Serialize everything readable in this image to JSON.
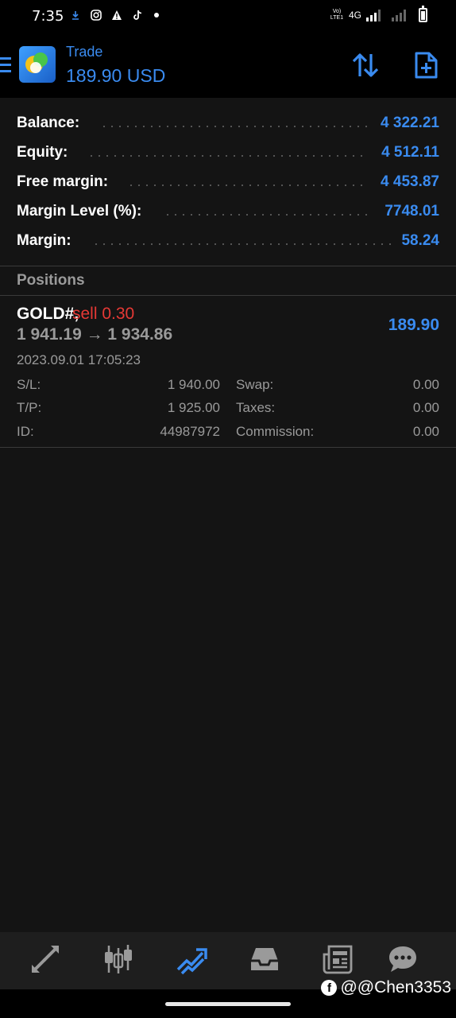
{
  "status_bar": {
    "time": "7:35",
    "volte": "Vo) LTE1",
    "network": "4G"
  },
  "header": {
    "title": "Trade",
    "subtitle": "189.90 USD",
    "icons": [
      "menu-icon",
      "app-logo",
      "sort-icon",
      "new-order-icon"
    ]
  },
  "account": {
    "rows": [
      {
        "label": "Balance:",
        "value": "4 322.21"
      },
      {
        "label": "Equity:",
        "value": "4 512.11"
      },
      {
        "label": "Free margin:",
        "value": "4 453.87"
      },
      {
        "label": "Margin Level (%):",
        "value": "7748.01"
      },
      {
        "label": "Margin:",
        "value": "58.24"
      }
    ]
  },
  "positions": {
    "title": "Positions",
    "items": [
      {
        "symbol": "GOLD#,",
        "side": "sell 0.30",
        "prices": "1 941.19 → 1 934.86",
        "profit": "189.90",
        "time": "2023.09.01 17:05:23",
        "details": {
          "sl_label": "S/L:",
          "sl_value": "1 940.00",
          "tp_label": "T/P:",
          "tp_value": "1 925.00",
          "id_label": "ID:",
          "id_value": "44987972",
          "swap_label": "Swap:",
          "swap_value": "0.00",
          "taxes_label": "Taxes:",
          "taxes_value": "0.00",
          "commission_label": "Commission:",
          "commission_value": "0.00"
        }
      }
    ]
  },
  "bottom_nav": {
    "items": [
      "quotes-icon",
      "chart-icon",
      "trade-icon",
      "history-icon",
      "news-icon",
      "messages-icon"
    ],
    "active": "trade-icon"
  },
  "watermark": "@@Chen3353",
  "colors": {
    "accent": "#3a8bf0",
    "sell": "#e53935",
    "background": "#141414",
    "header": "#000000"
  }
}
